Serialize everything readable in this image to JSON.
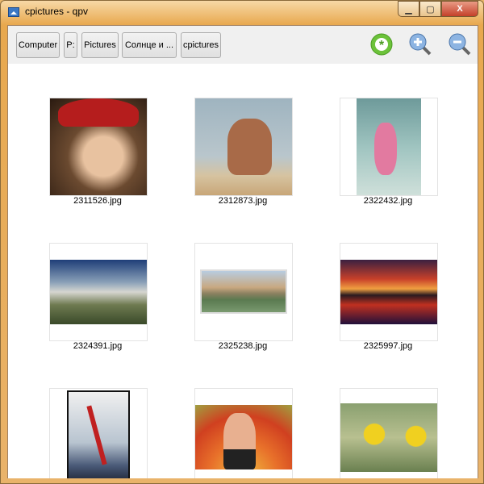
{
  "window": {
    "title": "cpictures - qpv",
    "minimize": "▁",
    "maximize": "▢",
    "close": "X"
  },
  "breadcrumbs": [
    "Computer",
    "P:",
    "Pictures",
    "Солнце и ...",
    "cpictures"
  ],
  "toolbar": {
    "icons": [
      "select-all-icon",
      "zoom-in-icon",
      "zoom-out-icon"
    ],
    "accent": "#6cc23a"
  },
  "thumbnails": [
    {
      "name": "2311526.jpg"
    },
    {
      "name": "2312873.jpg"
    },
    {
      "name": "2322432.jpg"
    },
    {
      "name": "2324391.jpg"
    },
    {
      "name": "2325238.jpg"
    },
    {
      "name": "2325997.jpg"
    },
    {
      "name": ""
    },
    {
      "name": ""
    },
    {
      "name": ""
    }
  ]
}
